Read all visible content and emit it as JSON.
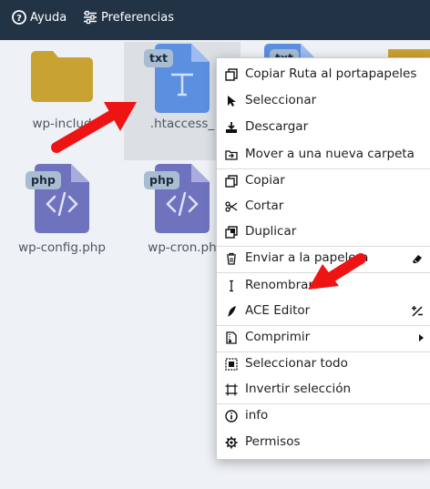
{
  "toolbar": {
    "help_label": "Ayuda",
    "prefs_label": "Preferencias"
  },
  "files": [
    {
      "name": "wp-includes",
      "display": "wp-includ",
      "type": "folder",
      "badge": ""
    },
    {
      "name": ".htaccess",
      "display": ".htaccess_",
      "type": "txt",
      "badge": "txt"
    },
    {
      "name": "",
      "display": "",
      "type": "txt",
      "badge": "txt"
    },
    {
      "name": "",
      "display": "",
      "type": "other",
      "badge": ""
    },
    {
      "name": "wp-config.php",
      "display": "wp-config.php",
      "type": "php",
      "badge": "php"
    },
    {
      "name": "wp-cron.php",
      "display": "wp-cron.ph",
      "type": "php",
      "badge": "php"
    }
  ],
  "context_menu": {
    "items": [
      {
        "label": "Copiar Ruta al portapapeles",
        "icon": "copy-path-icon"
      },
      {
        "label": "Seleccionar",
        "icon": "cursor-icon"
      },
      {
        "label": "Descargar",
        "icon": "download-icon"
      },
      {
        "label": "Mover a una nueva carpeta",
        "icon": "move-folder-icon"
      },
      {
        "label": "Copiar",
        "icon": "copy-icon"
      },
      {
        "label": "Cortar",
        "icon": "scissors-icon"
      },
      {
        "label": "Duplicar",
        "icon": "duplicate-icon"
      },
      {
        "label": "Enviar a la papelera",
        "icon": "trash-icon",
        "right_icon": "eraser-icon"
      },
      {
        "label": "Renombrar",
        "icon": "text-cursor-icon"
      },
      {
        "label": "ACE Editor",
        "icon": "quill-icon",
        "right_icon": "plus-minus-icon"
      },
      {
        "label": "Comprimir",
        "icon": "archive-icon",
        "right_icon": "submenu-arrow-icon"
      },
      {
        "label": "Seleccionar todo",
        "icon": "select-all-icon"
      },
      {
        "label": "Invertir selección",
        "icon": "invert-selection-icon"
      },
      {
        "label": "info",
        "icon": "info-icon"
      },
      {
        "label": "Permisos",
        "icon": "gear-icon"
      }
    ]
  },
  "colors": {
    "topbar": "#233346",
    "folder": "#c9a331",
    "txt_file": "#5b8fe0",
    "php_file": "#6f73bd",
    "annotation_arrow": "#ee1414"
  }
}
